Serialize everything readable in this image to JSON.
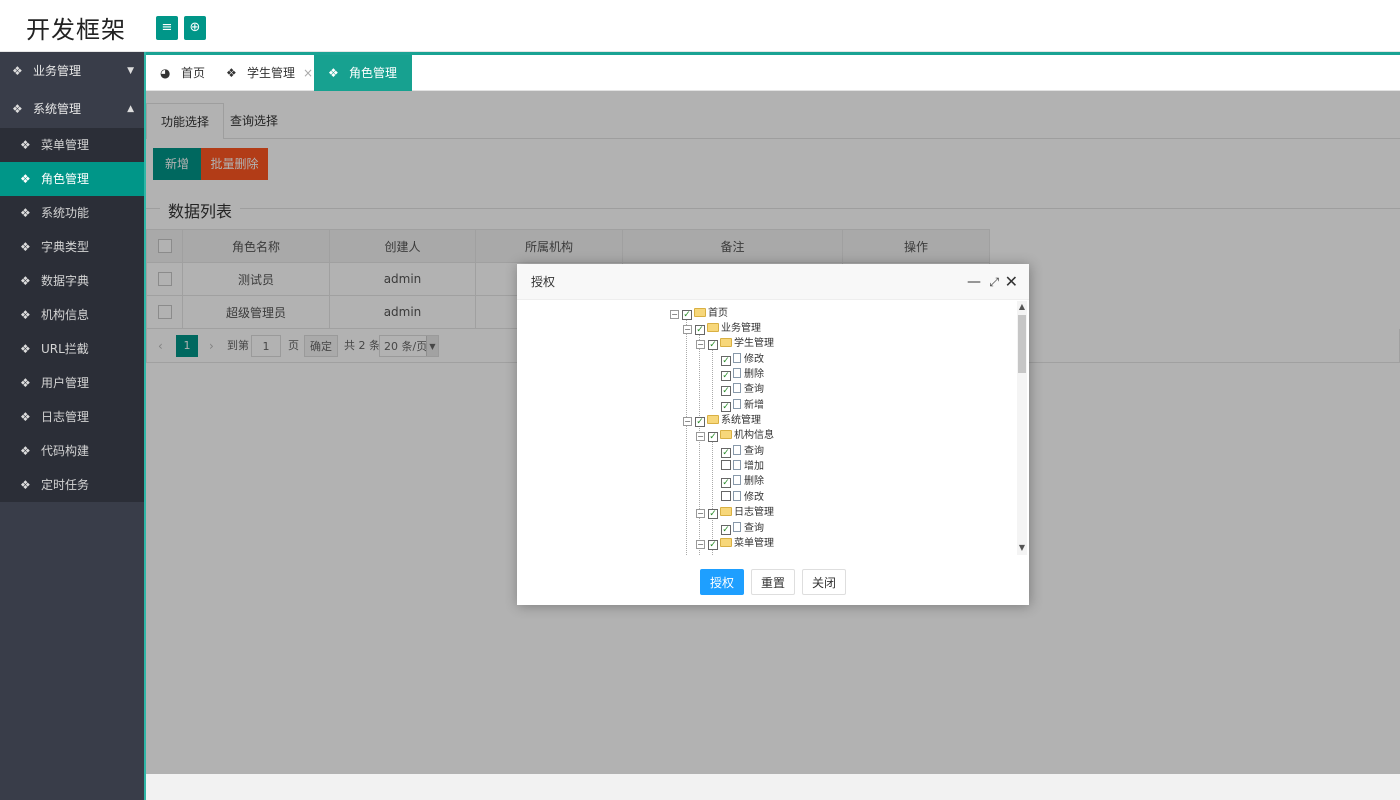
{
  "header": {
    "logo": "开发框架",
    "menu_icon": "≡",
    "globe_icon": "⊕"
  },
  "sidebar": {
    "groups": [
      {
        "label": "业务管理",
        "arrow": "▼"
      },
      {
        "label": "系统管理",
        "arrow": "▲"
      }
    ],
    "items": [
      {
        "label": "菜单管理"
      },
      {
        "label": "角色管理"
      },
      {
        "label": "系统功能"
      },
      {
        "label": "字典类型"
      },
      {
        "label": "数据字典"
      },
      {
        "label": "机构信息"
      },
      {
        "label": "URL拦截"
      },
      {
        "label": "用户管理"
      },
      {
        "label": "日志管理"
      },
      {
        "label": "代码构建"
      },
      {
        "label": "定时任务"
      }
    ]
  },
  "tabs": [
    {
      "label": "首页"
    },
    {
      "label": "学生管理",
      "close": "×"
    },
    {
      "label": "角色管理",
      "close": "×"
    }
  ],
  "content": {
    "subtabs": [
      "功能选择",
      "查询选择"
    ],
    "add_button": "新增",
    "batch_delete_button": "批量删除",
    "legend": "数据列表",
    "table": {
      "headers": [
        "角色名称",
        "创建人",
        "所属机构",
        "备注",
        "操作"
      ],
      "rows": [
        [
          "测试员",
          "admin",
          "",
          "",
          ""
        ],
        [
          "超级管理员",
          "admin",
          "",
          "",
          ""
        ]
      ]
    },
    "pager": {
      "prev": "‹",
      "page": "1",
      "next": "›",
      "goto_label": "到第",
      "goto_value": "1",
      "page_unit": "页",
      "confirm": "确定",
      "total": "共 2 条",
      "page_size": "20 条/页"
    }
  },
  "modal": {
    "title": "授权",
    "min_icon": "—",
    "max_icon": "⤢",
    "close_icon": "✕",
    "tree": [
      {
        "label": "首页",
        "checked": true
      },
      {
        "label": "业务管理",
        "checked": true
      },
      {
        "label": "学生管理",
        "checked": true
      },
      {
        "label": "修改",
        "checked": true
      },
      {
        "label": "删除",
        "checked": true
      },
      {
        "label": "查询",
        "checked": true
      },
      {
        "label": "新增",
        "checked": true
      },
      {
        "label": "系统管理",
        "checked": true
      },
      {
        "label": "机构信息",
        "checked": true
      },
      {
        "label": "查询",
        "checked": true
      },
      {
        "label": "增加",
        "checked": false
      },
      {
        "label": "删除",
        "checked": true
      },
      {
        "label": "修改",
        "checked": false
      },
      {
        "label": "日志管理",
        "checked": true
      },
      {
        "label": "查询",
        "checked": true
      },
      {
        "label": "菜单管理",
        "checked": true
      }
    ],
    "buttons": {
      "authorize": "授权",
      "reset": "重置",
      "close": "关闭"
    }
  },
  "colors": {
    "accent": "#009688",
    "danger": "#ff5722",
    "primary": "#1e9fff",
    "sidebar": "#393d49"
  }
}
